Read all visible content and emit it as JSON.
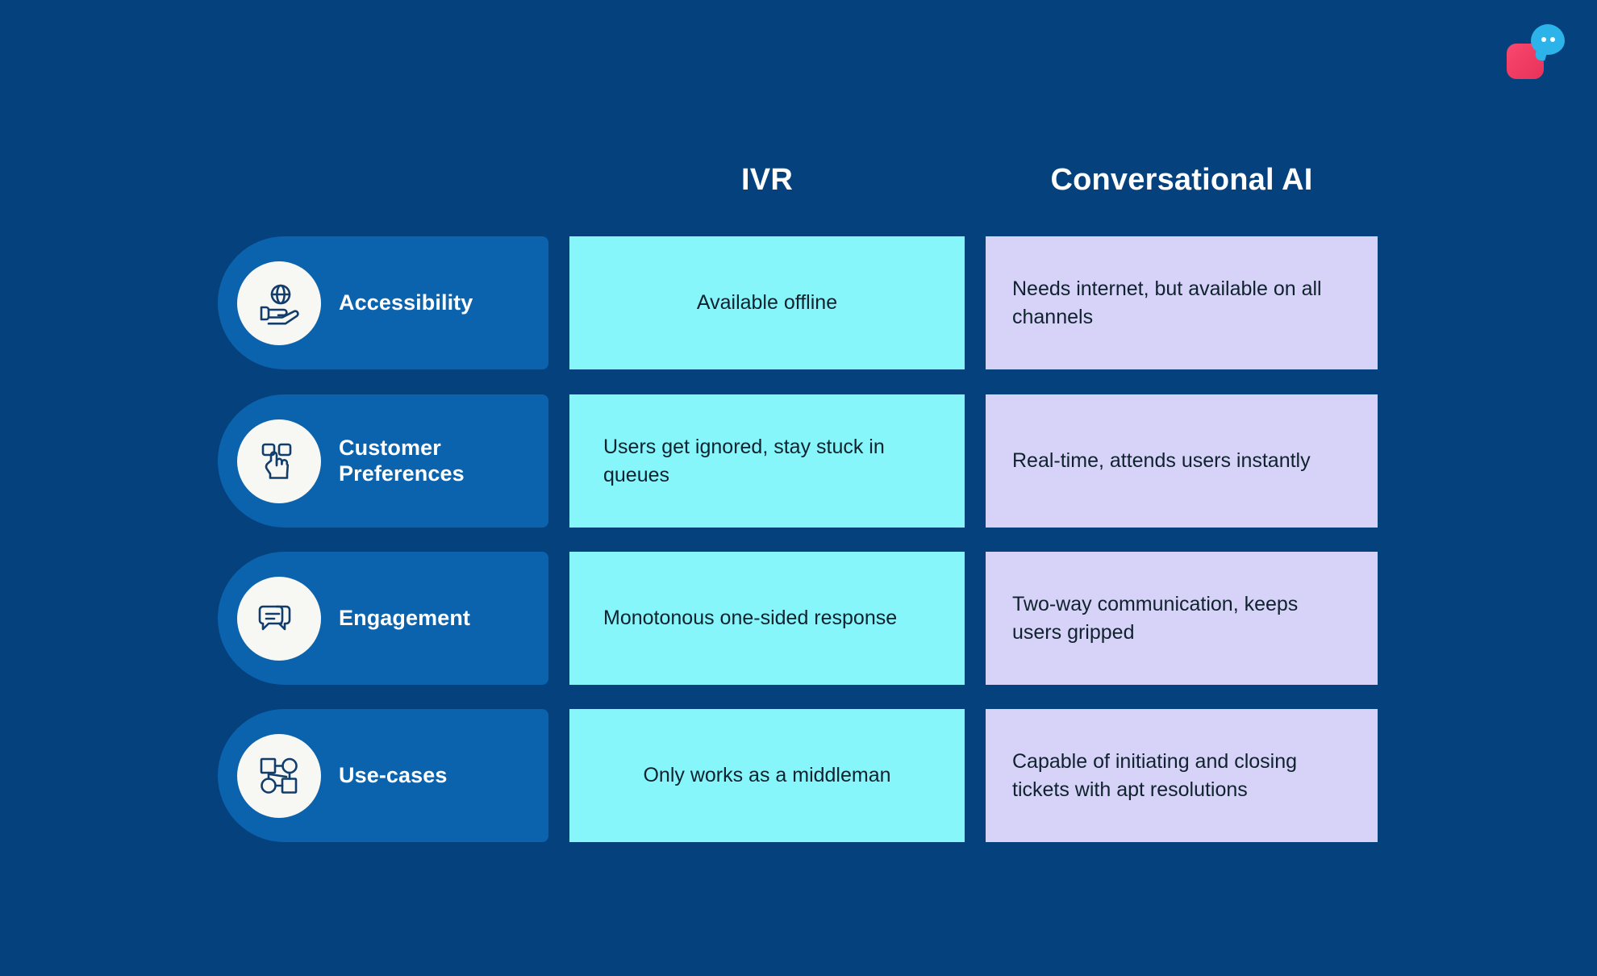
{
  "background_color": "#05417c",
  "logo": {
    "name": "brand-logo",
    "square_color": "#ef3b62",
    "bubble_color": "#2bb3ea"
  },
  "columns": {
    "label_header": "",
    "ivr_header": "IVR",
    "ai_header": "Conversational AI",
    "ivr_cell_color": "#87f6fb",
    "ai_cell_color": "#d6d2f8",
    "pill_color": "#0b63ae"
  },
  "rows": [
    {
      "label": "Accessibility",
      "icon": "globe-in-hand-icon",
      "ivr": "Available offline",
      "ai": "Needs internet, but available on all channels"
    },
    {
      "label": "Customer Preferences",
      "icon": "click-hand-icon",
      "ivr": "Users get ignored, stay stuck in queues",
      "ai": "Real-time, attends users instantly"
    },
    {
      "label": "Engagement",
      "icon": "chat-bubbles-icon",
      "ivr": "Monotonous one-sided response",
      "ai": "Two-way communication, keeps users gripped"
    },
    {
      "label": "Use-cases",
      "icon": "network-nodes-icon",
      "ivr": "Only works as a middleman",
      "ai": "Capable of initiating and closing tickets with apt resolutions"
    }
  ]
}
